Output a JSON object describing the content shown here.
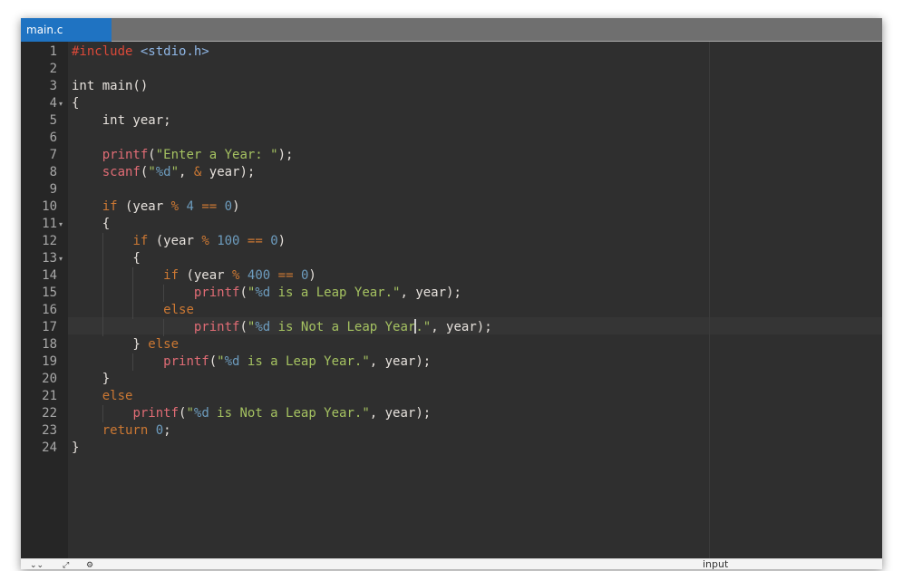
{
  "tab": {
    "filename": "main.c"
  },
  "status": {
    "input_label": "input"
  },
  "icons": [
    "collapse-icon",
    "expand-icon",
    "settings-icon"
  ],
  "code": {
    "line_numbers": [
      "1",
      "2",
      "3",
      "4",
      "5",
      "6",
      "7",
      "8",
      "9",
      "10",
      "11",
      "12",
      "13",
      "14",
      "15",
      "16",
      "17",
      "18",
      "19",
      "20",
      "21",
      "22",
      "23",
      "24"
    ],
    "lines": [
      [
        [
          "pre",
          "#include "
        ],
        [
          "pre2",
          "<stdio.h>"
        ]
      ],
      [],
      [
        [
          "plain",
          "int main()"
        ]
      ],
      [
        [
          "plain",
          "{"
        ]
      ],
      [
        [
          "plain",
          "    int year;"
        ]
      ],
      [],
      [
        [
          "plain",
          "    "
        ],
        [
          "fn",
          "printf"
        ],
        [
          "plain",
          "("
        ],
        [
          "str",
          "\"Enter a Year: \""
        ],
        [
          "plain",
          ");"
        ]
      ],
      [
        [
          "plain",
          "    "
        ],
        [
          "fn",
          "scanf"
        ],
        [
          "plain",
          "("
        ],
        [
          "str",
          "\""
        ],
        [
          "fmt",
          "%d"
        ],
        [
          "str",
          "\""
        ],
        [
          "plain",
          ", "
        ],
        [
          "op",
          "&"
        ],
        [
          "plain",
          " year);"
        ]
      ],
      [],
      [
        [
          "plain",
          "    "
        ],
        [
          "kw",
          "if"
        ],
        [
          "plain",
          " (year "
        ],
        [
          "op",
          "%"
        ],
        [
          "plain",
          " "
        ],
        [
          "num",
          "4"
        ],
        [
          "plain",
          " "
        ],
        [
          "op",
          "=="
        ],
        [
          "plain",
          " "
        ],
        [
          "num",
          "0"
        ],
        [
          "plain",
          ")"
        ]
      ],
      [
        [
          "plain",
          "    {"
        ]
      ],
      [
        [
          "plain",
          "        "
        ],
        [
          "kw",
          "if"
        ],
        [
          "plain",
          " (year "
        ],
        [
          "op",
          "%"
        ],
        [
          "plain",
          " "
        ],
        [
          "num",
          "100"
        ],
        [
          "plain",
          " "
        ],
        [
          "op",
          "=="
        ],
        [
          "plain",
          " "
        ],
        [
          "num",
          "0"
        ],
        [
          "plain",
          ")"
        ]
      ],
      [
        [
          "plain",
          "        {"
        ]
      ],
      [
        [
          "plain",
          "            "
        ],
        [
          "kw",
          "if"
        ],
        [
          "plain",
          " (year "
        ],
        [
          "op",
          "%"
        ],
        [
          "plain",
          " "
        ],
        [
          "num",
          "400"
        ],
        [
          "plain",
          " "
        ],
        [
          "op",
          "=="
        ],
        [
          "plain",
          " "
        ],
        [
          "num",
          "0"
        ],
        [
          "plain",
          ")"
        ]
      ],
      [
        [
          "plain",
          "                "
        ],
        [
          "fn",
          "printf"
        ],
        [
          "plain",
          "("
        ],
        [
          "str",
          "\""
        ],
        [
          "fmt",
          "%d"
        ],
        [
          "str",
          " is a Leap Year.\""
        ],
        [
          "plain",
          ", year);"
        ]
      ],
      [
        [
          "plain",
          "            "
        ],
        [
          "kw",
          "else"
        ]
      ],
      [
        [
          "plain",
          "                "
        ],
        [
          "fn",
          "printf"
        ],
        [
          "plain",
          "("
        ],
        [
          "str",
          "\""
        ],
        [
          "fmt",
          "%d"
        ],
        [
          "str",
          " is Not a Leap Year"
        ],
        [
          "cursor",
          ""
        ],
        [
          "str",
          ".\""
        ],
        [
          "plain",
          ", year);"
        ]
      ],
      [
        [
          "plain",
          "        } "
        ],
        [
          "kw",
          "else"
        ]
      ],
      [
        [
          "plain",
          "            "
        ],
        [
          "fn",
          "printf"
        ],
        [
          "plain",
          "("
        ],
        [
          "str",
          "\""
        ],
        [
          "fmt",
          "%d"
        ],
        [
          "str",
          " is a Leap Year.\""
        ],
        [
          "plain",
          ", year);"
        ]
      ],
      [
        [
          "plain",
          "    }"
        ]
      ],
      [
        [
          "plain",
          "    "
        ],
        [
          "kw",
          "else"
        ]
      ],
      [
        [
          "plain",
          "        "
        ],
        [
          "fn",
          "printf"
        ],
        [
          "plain",
          "("
        ],
        [
          "str",
          "\""
        ],
        [
          "fmt",
          "%d"
        ],
        [
          "str",
          " is Not a Leap Year.\""
        ],
        [
          "plain",
          ", year);"
        ]
      ],
      [
        [
          "plain",
          "    "
        ],
        [
          "kw",
          "return"
        ],
        [
          "plain",
          " "
        ],
        [
          "num",
          "0"
        ],
        [
          "plain",
          ";"
        ]
      ],
      [
        [
          "plain",
          "}"
        ]
      ]
    ],
    "fold_markers": [
      "4",
      "11",
      "13"
    ],
    "active_line": "17"
  }
}
